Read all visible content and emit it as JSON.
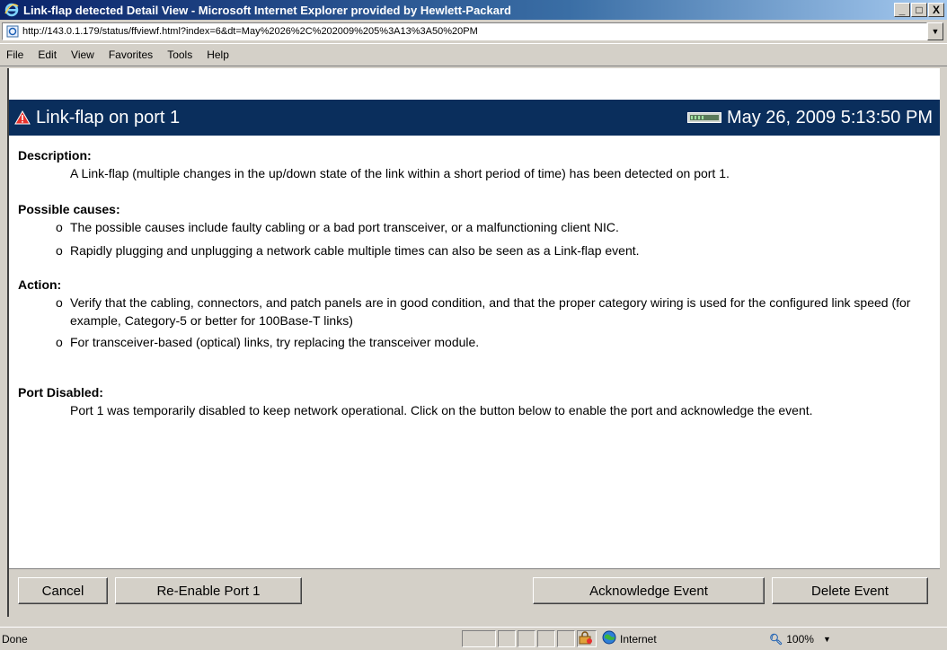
{
  "window": {
    "title": "Link-flap detected Detail View - Microsoft Internet Explorer provided by Hewlett-Packard",
    "minimize": "_",
    "maximize": "□",
    "close": "X"
  },
  "address": {
    "url": "http://143.0.1.179/status/ffviewf.html?index=6&dt=May%2026%2C%202009%205%3A13%3A50%20PM"
  },
  "menu": [
    "File",
    "Edit",
    "View",
    "Favorites",
    "Tools",
    "Help"
  ],
  "header": {
    "title": "Link-flap on port 1",
    "date": "May 26, 2009 5:13:50 PM",
    "header_bg": "#0a2e5c",
    "warning_icon": "warning-triangle-icon",
    "device_icon": "switch-icon"
  },
  "description": {
    "heading": "Description:",
    "text": "A Link-flap (multiple changes in the up/down state of the link within a short period of time) has been detected on port 1."
  },
  "causes": {
    "heading": "Possible causes:",
    "items": [
      "The possible causes include faulty cabling or a bad port transceiver, or a malfunctioning client NIC.",
      "Rapidly plugging and unplugging a network cable multiple times can also be seen as a Link-flap event."
    ]
  },
  "action": {
    "heading": "Action:",
    "items": [
      "Verify that the cabling, connectors, and patch panels are in good condition, and that the proper category wiring is used for the configured link speed (for example, Category-5 or better for 100Base-T links)",
      "For transceiver-based (optical) links, try replacing the transceiver module."
    ]
  },
  "port_disabled": {
    "heading": "Port Disabled:",
    "text": "Port 1 was temporarily disabled to keep network operational. Click on the button below to enable the port and acknowledge the event."
  },
  "buttons": {
    "cancel": "Cancel",
    "reenable": "Re-Enable Port 1",
    "acknowledge": "Acknowledge Event",
    "delete": "Delete Event"
  },
  "status": {
    "text": "Done",
    "zone": "Internet",
    "zoom": "100%"
  }
}
